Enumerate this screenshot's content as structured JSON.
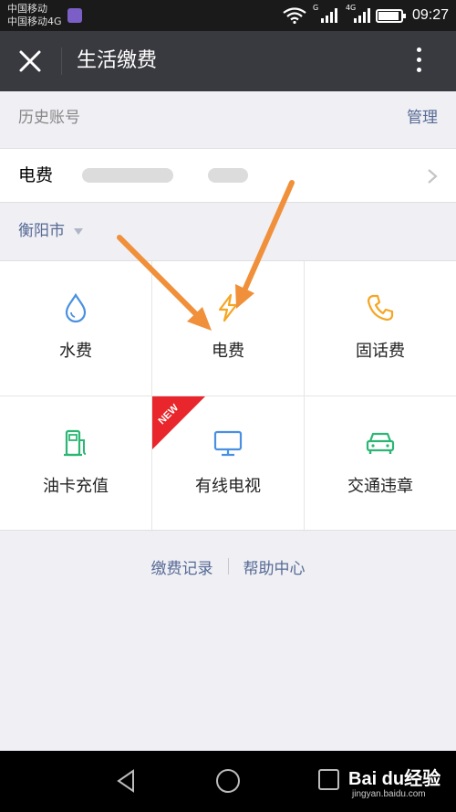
{
  "status_bar": {
    "carrier_1": "中国移动",
    "carrier_2": "中国移动4G",
    "signal_1_tag": "G",
    "signal_2_tag": "4G",
    "time": "09:27"
  },
  "nav": {
    "title": "生活缴费",
    "close_icon": "close-icon",
    "more_icon": "more-vertical-icon"
  },
  "history": {
    "label": "历史账号",
    "manage_label": "管理"
  },
  "account": {
    "type": "电费"
  },
  "city": {
    "name": "衡阳市"
  },
  "services": [
    {
      "label": "水费",
      "icon": "water-drop-icon",
      "color": "#4a90e2"
    },
    {
      "label": "电费",
      "icon": "lightning-icon",
      "color": "#f5a623"
    },
    {
      "label": "固话费",
      "icon": "phone-icon",
      "color": "#f5a623"
    },
    {
      "label": "油卡充值",
      "icon": "fuel-pump-icon",
      "color": "#2bb673"
    },
    {
      "label": "有线电视",
      "icon": "tv-monitor-icon",
      "color": "#4a90e2",
      "badge": "NEW"
    },
    {
      "label": "交通违章",
      "icon": "car-icon",
      "color": "#2bb673"
    }
  ],
  "footer": {
    "records": "缴费记录",
    "help": "帮助中心"
  },
  "watermark": {
    "main": "Bai du经验",
    "sub": "jingyan.baidu.com"
  },
  "colors": {
    "link": "#576b95",
    "nav_bg": "#393a3f",
    "annotation_arrow": "#f0903a",
    "badge_red": "#e8262b"
  }
}
